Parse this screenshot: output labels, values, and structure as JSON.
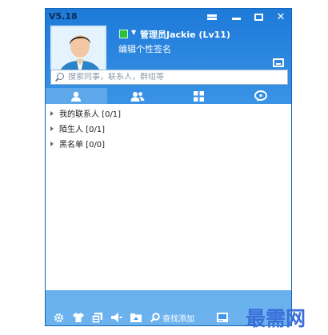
{
  "app": {
    "version": "V5.18"
  },
  "profile": {
    "username": "管理员Jackie (Lv11)",
    "signature": "编辑个性签名",
    "status": "online"
  },
  "search": {
    "placeholder": "搜索同事，联系人，群组等"
  },
  "tabs": [
    {
      "icon": "contacts-icon",
      "active": true
    },
    {
      "icon": "groups-icon",
      "active": false
    },
    {
      "icon": "apps-icon",
      "active": false
    },
    {
      "icon": "recent-icon",
      "active": false
    }
  ],
  "groups": [
    {
      "label": "我的联系人 [0/1]"
    },
    {
      "label": "陌生人 [0/1]"
    },
    {
      "label": "黑名单 [0/0]"
    }
  ],
  "toolbar": {
    "find_add_label": "查找添加",
    "icons": [
      "gear-icon",
      "shirt-icon",
      "file-icon",
      "speaker-icon",
      "folder-icon",
      "search-icon",
      "message-manager-icon"
    ]
  },
  "watermark": {
    "text": "最需网",
    "color": "#3a6fd8"
  },
  "colors": {
    "title_bar": "#1d7ad8",
    "accent": "#3a93e6",
    "list_bg": "#ffffff"
  }
}
